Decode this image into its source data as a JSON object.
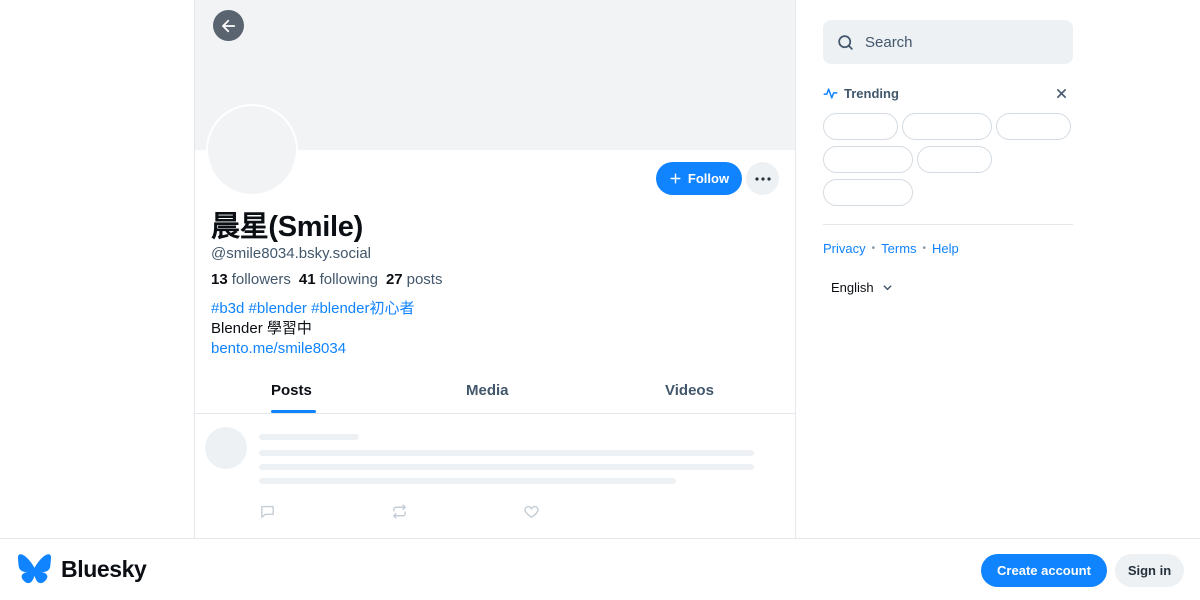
{
  "profile": {
    "display_name": "晨星(Smile)",
    "handle": "@smile8034.bsky.social",
    "followers_count": "13",
    "followers_label": "followers",
    "following_count": "41",
    "following_label": "following",
    "posts_count": "27",
    "posts_label": "posts",
    "bio_tags": [
      "#b3d",
      "#blender",
      "#blender初心者"
    ],
    "bio_text": "Blender 學習中",
    "bio_link": "bento.me/smile8034"
  },
  "actions": {
    "follow_label": "Follow"
  },
  "tabs": [
    {
      "label": "Posts",
      "active": true
    },
    {
      "label": "Media",
      "active": false
    },
    {
      "label": "Videos",
      "active": false
    }
  ],
  "search": {
    "placeholder": "Search"
  },
  "trending": {
    "title": "Trending"
  },
  "footer": {
    "links": [
      "Privacy",
      "Terms",
      "Help"
    ],
    "language": "English"
  },
  "bottom_bar": {
    "brand": "Bluesky",
    "create_account_label": "Create account",
    "sign_in_label": "Sign in"
  },
  "colors": {
    "accent": "#1083fe",
    "muted_text": "#42576c",
    "skeleton": "#eef1f4"
  },
  "icons": {
    "back": "arrow-left-icon",
    "follow": "plus-icon",
    "more": "ellipsis-icon",
    "search": "search-icon",
    "trending": "trending-icon",
    "close": "close-icon",
    "reply": "reply-icon",
    "repost": "repost-icon",
    "like": "heart-icon",
    "language": "chevron-down-icon",
    "brand": "butterfly-logo"
  }
}
